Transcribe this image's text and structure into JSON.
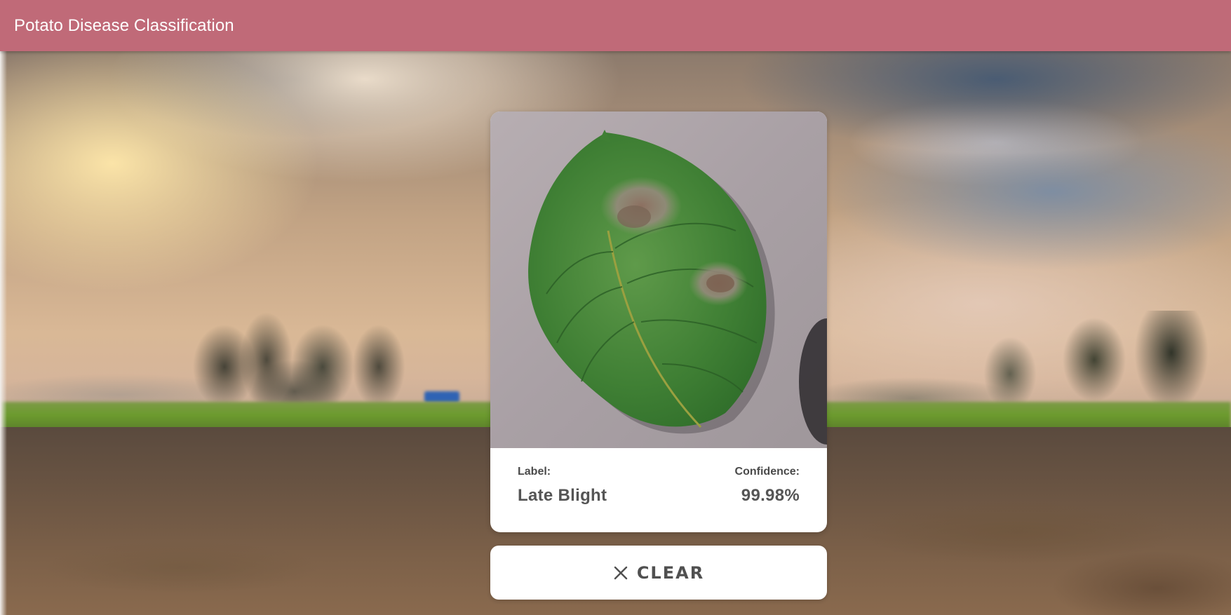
{
  "header": {
    "title": "Potato Disease Classification",
    "background_color": "#c06a78"
  },
  "result": {
    "image_alt": "Uploaded potato leaf",
    "label_caption": "Label:",
    "label_value": "Late Blight",
    "confidence_caption": "Confidence:",
    "confidence_value": "99.98%"
  },
  "actions": {
    "clear_label": "CLEAR",
    "clear_icon": "close-icon"
  }
}
